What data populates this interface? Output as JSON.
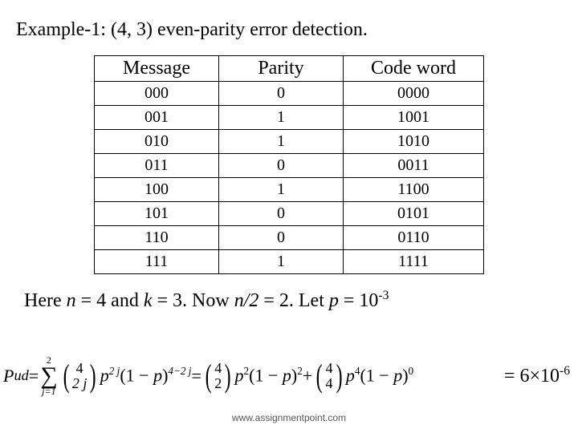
{
  "title": "Example-1: (4, 3) even-parity  error detection.",
  "table": {
    "headers": {
      "message": "Message",
      "parity": "Parity",
      "code": "Code word"
    },
    "rows": [
      {
        "message": "000",
        "parity": "0",
        "code": "0000"
      },
      {
        "message": "001",
        "parity": "1",
        "code": "1001"
      },
      {
        "message": "010",
        "parity": "1",
        "code": "1010"
      },
      {
        "message": "011",
        "parity": "0",
        "code": "0011"
      },
      {
        "message": "100",
        "parity": "1",
        "code": "1100"
      },
      {
        "message": "101",
        "parity": "0",
        "code": "0101"
      },
      {
        "message": "110",
        "parity": "0",
        "code": "0110"
      },
      {
        "message": "111",
        "parity": "1",
        "code": "1111"
      }
    ]
  },
  "statement": {
    "pre": "Here ",
    "n": "n",
    "eqn": " = 4 and ",
    "k": "k",
    "eqk": " = 3. Now ",
    "half": "n/2",
    "eqhalf": " = 2. Let ",
    "p": "p",
    "eqp": " = 10",
    "pexp": "-3"
  },
  "formula": {
    "lhs": "P",
    "lhs_sub": "ud",
    "eq": " = ",
    "sum_top": "2",
    "sum_sym": "∑",
    "sum_bot": "j=1",
    "b1_top": "4",
    "b1_bot": "2 j",
    "t1a": "p",
    "t1a_exp": "2 j",
    "t1b_open": "(1 − ",
    "t1b_p": "p",
    "t1b_close": ")",
    "t1b_exp": "4−2 j",
    "mid": " = ",
    "b2_top": "4",
    "b2_bot": "2",
    "t2a": "p",
    "t2a_exp": "2",
    "t2b_open": "(1 − ",
    "t2b_p": "p",
    "t2b_close": ")",
    "t2b_exp": "2",
    "plus": " + ",
    "b3_top": "4",
    "b3_bot": "4",
    "t3a": "p",
    "t3a_exp": "4",
    "t3b_open": "(1 − ",
    "t3b_p": "p",
    "t3b_close": ")",
    "t3b_exp": "0"
  },
  "result": {
    "eq": "= 6×10",
    "exp": "-6"
  },
  "footer": "www.assignmentpoint.com",
  "chart_data": {
    "type": "table",
    "title": "Example-1: (4, 3) even-parity error detection.",
    "columns": [
      "Message",
      "Parity",
      "Code word"
    ],
    "rows": [
      [
        "000",
        "0",
        "0000"
      ],
      [
        "001",
        "1",
        "1001"
      ],
      [
        "010",
        "1",
        "1010"
      ],
      [
        "011",
        "0",
        "0011"
      ],
      [
        "100",
        "1",
        "1100"
      ],
      [
        "101",
        "0",
        "0101"
      ],
      [
        "110",
        "0",
        "0110"
      ],
      [
        "111",
        "1",
        "1111"
      ]
    ],
    "parameters": {
      "n": 4,
      "k": 3,
      "n_over_2": 2,
      "p": 0.001,
      "P_ud": 6e-06
    }
  }
}
